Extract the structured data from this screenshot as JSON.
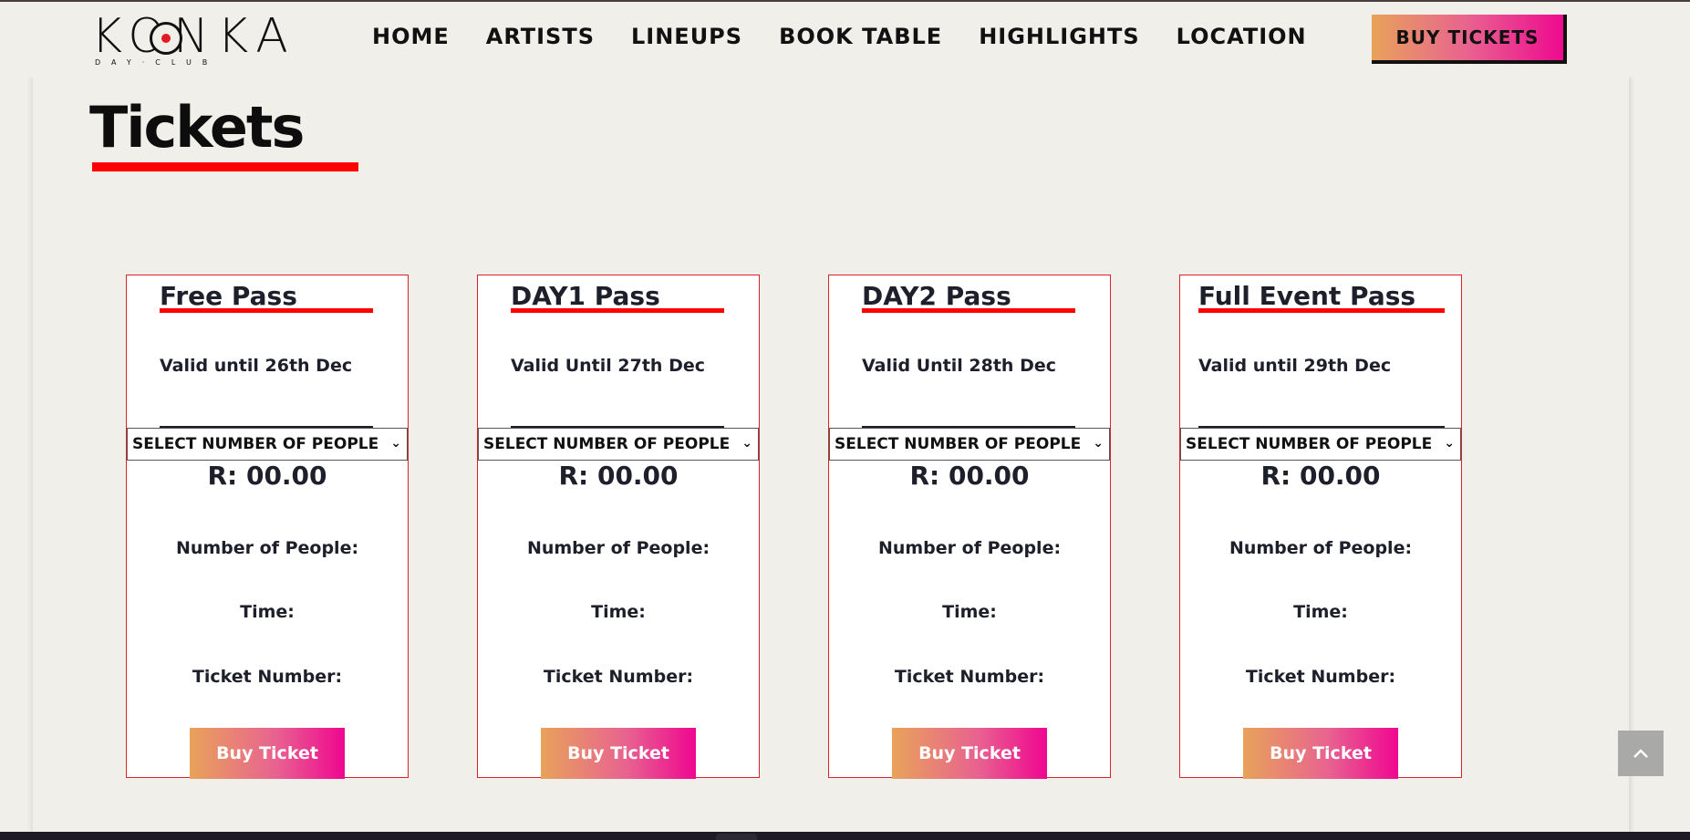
{
  "header": {
    "logo_word": "KONKA",
    "logo_sub": "DAY·CLUB",
    "nav": [
      "HOME",
      "ARTISTS",
      "LINEUPS",
      "BOOK TABLE",
      "HIGHLIGHTS",
      "LOCATION"
    ],
    "buy_tickets_label": "BUY TICKETS"
  },
  "page_title": "Tickets",
  "cards": [
    {
      "name": "Free Pass",
      "valid": "Valid until 26th Dec",
      "select_label": "SELECT NUMBER OF PEOPLE",
      "price": "R: 00.00",
      "people_label": "Number of People:",
      "time_label": "Time:",
      "ticket_label": "Ticket Number:",
      "buy_label": "Buy Ticket"
    },
    {
      "name": "DAY1 Pass",
      "valid": "Valid Until 27th Dec",
      "select_label": "SELECT NUMBER OF PEOPLE",
      "price": "R: 00.00",
      "people_label": "Number of People:",
      "time_label": "Time:",
      "ticket_label": "Ticket Number:",
      "buy_label": "Buy Ticket"
    },
    {
      "name": "DAY2 Pass",
      "valid": "Valid Until 28th Dec",
      "select_label": "SELECT NUMBER OF PEOPLE",
      "price": "R: 00.00",
      "people_label": "Number of People:",
      "time_label": "Time:",
      "ticket_label": "Ticket Number:",
      "buy_label": "Buy Ticket"
    },
    {
      "name": "Full Event Pass",
      "valid": "Valid until 29th Dec",
      "select_label": "SELECT NUMBER OF PEOPLE",
      "price": "R: 00.00",
      "people_label": "Number of People:",
      "time_label": "Time:",
      "ticket_label": "Ticket Number:",
      "buy_label": "Buy Ticket"
    }
  ],
  "colors": {
    "accent_red": "#ff0000",
    "gradient_start": "#e8a25a",
    "gradient_end": "#ee0a8f",
    "background": "#f0efe9"
  },
  "icons": [
    "chevron-down-icon",
    "chevron-up-icon"
  ]
}
